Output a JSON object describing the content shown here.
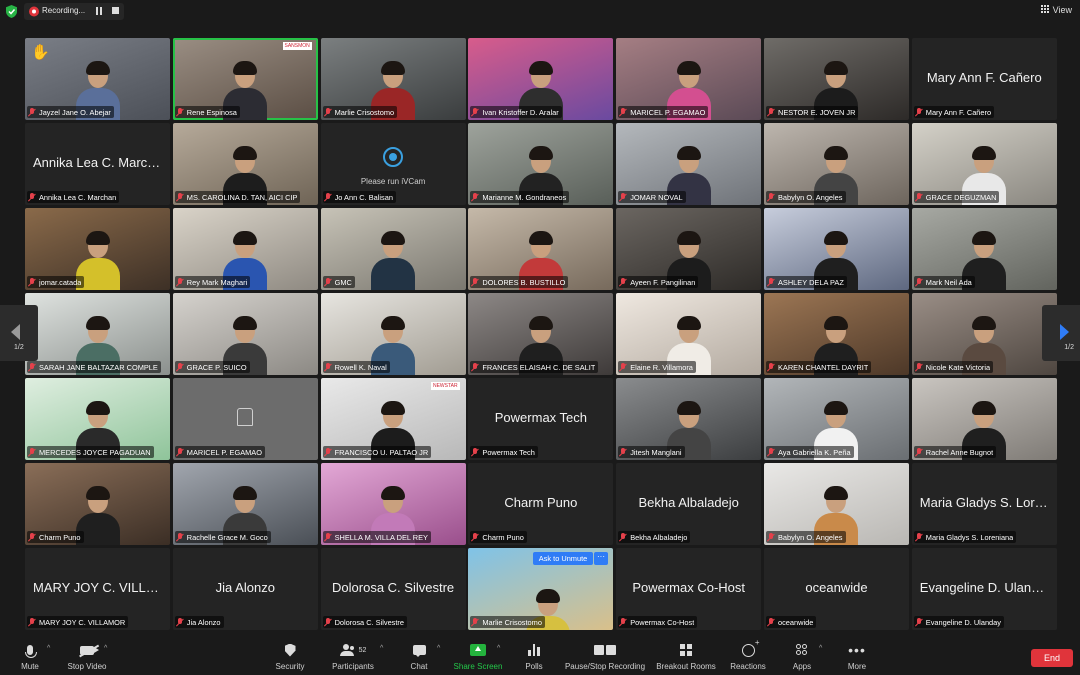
{
  "topbar": {
    "recording_label": "Recording...",
    "view_label": "View"
  },
  "pagination": {
    "left_label": "1/2",
    "right_label": "1/2"
  },
  "tiles": [
    {
      "name": "Jayzel Jane O. Abejar",
      "kind": "video",
      "hand": true,
      "c1": "#7a7e86",
      "c2": "#4c5058",
      "shirt": "#5a6f9a"
    },
    {
      "name": "Rene Espinosa",
      "kind": "video",
      "active": true,
      "logo": "SANSMON",
      "c1": "#9a8e83",
      "c2": "#5b4e44",
      "shirt": "#2c2c33"
    },
    {
      "name": "Marlie Crisostomo",
      "kind": "video",
      "c1": "#7b7f80",
      "c2": "#3a3d3e",
      "shirt": "#9a2626"
    },
    {
      "name": "Ivan Kristoffer D. Aralar",
      "kind": "video",
      "c1": "#d85c8b",
      "c2": "#6a4aa0",
      "shirt": "#2e2e2e"
    },
    {
      "name": "MARICEL P. EGAMAO",
      "kind": "video",
      "c1": "#a57e83",
      "c2": "#5b4a56",
      "shirt": "#d34f90"
    },
    {
      "name": "NESTOR E. JOVEN JR",
      "kind": "video",
      "c1": "#6f6c68",
      "c2": "#2d2a28",
      "shirt": "#1c1c1c"
    },
    {
      "name": "Mary Ann F. Cañero",
      "kind": "name",
      "big": "Mary Ann F. Cañero"
    },
    {
      "name": "Annika Lea C. Marchan",
      "kind": "name",
      "big": "Annika Lea C. March..."
    },
    {
      "name": "MS. CAROLINA D. TAN, AICI CIP",
      "kind": "video",
      "c1": "#b6aa9a",
      "c2": "#6f6456",
      "shirt": "#1d1d1d"
    },
    {
      "name": "Jo Ann C. Balisan",
      "kind": "ivcam",
      "ivcam": "Please run iVCam"
    },
    {
      "name": "Marianne M. Gondraneos",
      "kind": "video",
      "c1": "#9ea39c",
      "c2": "#595f59",
      "shirt": "#222"
    },
    {
      "name": "JOMAR NOVAL",
      "kind": "video",
      "c1": "#b4b8bc",
      "c2": "#6f7379",
      "shirt": "#334"
    },
    {
      "name": "Babylyn O. Angeles",
      "kind": "video",
      "c1": "#bdb6ae",
      "c2": "#6d655d",
      "shirt": "#444"
    },
    {
      "name": "GRACE DEGUZMAN",
      "kind": "video",
      "c1": "#d4d1c8",
      "c2": "#8a8780",
      "shirt": "#e8e8e8"
    },
    {
      "name": "jomar.catada",
      "kind": "video",
      "c1": "#8a6a4a",
      "c2": "#3d3026",
      "shirt": "#d4c02a"
    },
    {
      "name": "Rey Mark Maghari",
      "kind": "video",
      "c1": "#d9d3c8",
      "c2": "#8f8a82",
      "shirt": "#2a55b0"
    },
    {
      "name": "GMC",
      "kind": "video",
      "c1": "#c7c3b7",
      "c2": "#7b7870",
      "shirt": "#234"
    },
    {
      "name": "DOLORES B. BUSTILLO",
      "kind": "video",
      "c1": "#c5b9a9",
      "c2": "#776a5c",
      "shirt": "#c23a3a"
    },
    {
      "name": "Ayeen F. Pangilinan",
      "kind": "video",
      "c1": "#6b6661",
      "c2": "#2e2b28",
      "shirt": "#1c1c1c"
    },
    {
      "name": "ASHLEY DELA PAZ",
      "kind": "video",
      "c1": "#c7cddc",
      "c2": "#5e6880",
      "shirt": "#1f1f1f"
    },
    {
      "name": "Mark Neil Ada",
      "kind": "video",
      "c1": "#a7a9a3",
      "c2": "#62645e",
      "shirt": "#1f1f1f"
    },
    {
      "name": "SARAH JANE BALTAZAR COMPLE",
      "kind": "video",
      "c1": "#dfe3e0",
      "c2": "#8b908d",
      "shirt": "#4b6e64"
    },
    {
      "name": "GRACE P. SUICO",
      "kind": "video",
      "c1": "#d5d2cd",
      "c2": "#8c8984",
      "shirt": "#3a3a3a"
    },
    {
      "name": "Rowell K. Naval",
      "kind": "video",
      "c1": "#e7e5e0",
      "c2": "#a19c92",
      "shirt": "#3a5a7a"
    },
    {
      "name": "FRANCES ELAISAH C. DE SALIT",
      "kind": "video",
      "c1": "#8d8886",
      "c2": "#3e3a39",
      "shirt": "#1f1f1f"
    },
    {
      "name": "Elaine R. Villamora",
      "kind": "video",
      "c1": "#efe8e0",
      "c2": "#b3aaa0",
      "shirt": "#f0ece6"
    },
    {
      "name": "KAREN CHANTEL DAYRIT",
      "kind": "video",
      "c1": "#9c7654",
      "c2": "#4d3828",
      "shirt": "#1f1f1f"
    },
    {
      "name": "Nicole Kate Victoria",
      "kind": "video",
      "c1": "#9a8e86",
      "c2": "#4e4640",
      "shirt": "#5a4a40"
    },
    {
      "name": "MERCEDES JOYCE PAGADUAN",
      "kind": "video",
      "c1": "#dfeee0",
      "c2": "#8fc49a",
      "shirt": "#2a2a2a"
    },
    {
      "name": "MARICEL P. EGAMAO",
      "kind": "placeholder"
    },
    {
      "name": "FRANCISCO U. PALTAO JR",
      "kind": "video",
      "logo": "NEWSTAR",
      "c1": "#e9e9e9",
      "c2": "#b8b8b8",
      "shirt": "#1c1c1c"
    },
    {
      "name": "Powermax Tech",
      "kind": "name",
      "big": "Powermax Tech"
    },
    {
      "name": "Jitesh Manglani",
      "kind": "video",
      "c1": "#8a8c8e",
      "c2": "#3c3e40",
      "shirt": "#444"
    },
    {
      "name": "Aya Gabriella K. Peña",
      "kind": "video",
      "c1": "#b2b6b9",
      "c2": "#6a6e72",
      "shirt": "#f1f1f1"
    },
    {
      "name": "Rachel Anne Bugnot",
      "kind": "video",
      "c1": "#c9c5c0",
      "c2": "#7f7b76",
      "shirt": "#1f1f1f"
    },
    {
      "name": "Charm Puno",
      "kind": "video",
      "c1": "#8a6e58",
      "c2": "#3b2e25",
      "shirt": "#1f1f1f"
    },
    {
      "name": "Rachelle Grace M. Goco",
      "kind": "video",
      "c1": "#a1a6ae",
      "c2": "#4a4f56",
      "shirt": "#3a3a3a"
    },
    {
      "name": "SHELLA M. VILLA DEL REY",
      "kind": "video",
      "c1": "#e3a8d6",
      "c2": "#9a4f8c",
      "shirt": "#c27ab8"
    },
    {
      "name": "Charm Puno",
      "kind": "name",
      "big": "Charm Puno"
    },
    {
      "name": "Bekha Albaladejo",
      "kind": "name",
      "big": "Bekha Albaladejo"
    },
    {
      "name": "Babylyn O. Angeles",
      "kind": "video",
      "c1": "#e9e8e6",
      "c2": "#b9b7b3",
      "shirt": "#c98a4a"
    },
    {
      "name": "Maria Gladys S. Loreniana",
      "kind": "name",
      "big": "Maria Gladys S. Lore..."
    },
    {
      "name": "MARY JOY C. VILLAMOR",
      "kind": "name",
      "big": "MARY JOY C. VILLA..."
    },
    {
      "name": "Jia Alonzo",
      "kind": "name",
      "big": "Jia Alonzo"
    },
    {
      "name": "Dolorosa C. Silvestre",
      "kind": "name",
      "big": "Dolorosa C. Silvestre"
    },
    {
      "name": "Marlie Crisostomo",
      "kind": "beach",
      "c1": "#7fc3e8",
      "c2": "#d9c08a",
      "shirt": "#d6c040"
    },
    {
      "name": "Powermax Co-Host",
      "kind": "name",
      "big": "Powermax Co-Host"
    },
    {
      "name": "oceanwide",
      "kind": "name",
      "big": "oceanwide"
    },
    {
      "name": "Evangeline D. Ulanday",
      "kind": "name",
      "big": "Evangeline D. Ulanday"
    }
  ],
  "unmute": {
    "label": "Ask to Unmute",
    "more": "···"
  },
  "toolbar": {
    "mute": "Mute",
    "stop_video": "Stop Video",
    "security": "Security",
    "participants": "Participants",
    "participants_count": "52",
    "chat": "Chat",
    "share_screen": "Share Screen",
    "polls": "Polls",
    "pause_recording": "Pause/Stop Recording",
    "breakout_rooms": "Breakout Rooms",
    "reactions": "Reactions",
    "apps": "Apps",
    "more": "More",
    "end": "End"
  },
  "colors": {
    "share_green": "#24c94a",
    "end_red": "#e0343b",
    "active_speaker": "#27c247",
    "accent_blue": "#2f7cf6"
  }
}
